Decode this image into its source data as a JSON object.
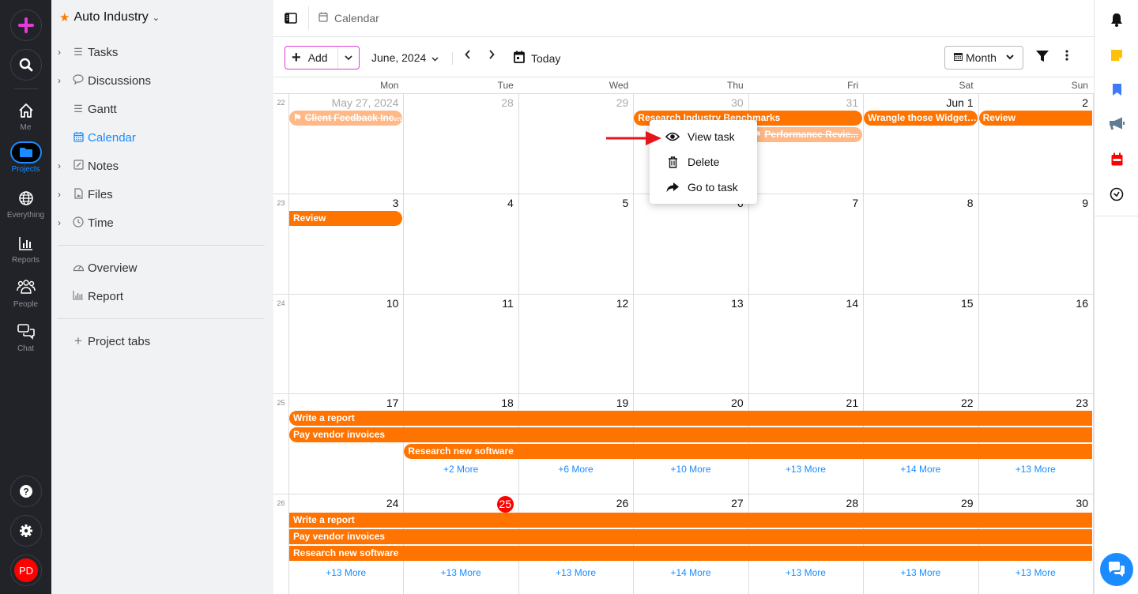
{
  "rail": {
    "items": [
      {
        "label": "Me",
        "icon": "home-icon"
      },
      {
        "label": "Projects",
        "icon": "folder-icon",
        "active": true
      },
      {
        "label": "Everything",
        "icon": "globe-icon"
      },
      {
        "label": "Reports",
        "icon": "bar-chart-icon"
      },
      {
        "label": "People",
        "icon": "people-icon"
      },
      {
        "label": "Chat",
        "icon": "chat-icon"
      }
    ],
    "avatar_initials": "PD"
  },
  "sidebar": {
    "project_name": "Auto Industry",
    "items": [
      {
        "label": "Tasks",
        "expandable": true
      },
      {
        "label": "Discussions",
        "expandable": true
      },
      {
        "label": "Gantt",
        "expandable": false
      },
      {
        "label": "Calendar",
        "expandable": false,
        "active": true
      },
      {
        "label": "Notes",
        "expandable": true
      },
      {
        "label": "Files",
        "expandable": true
      },
      {
        "label": "Time",
        "expandable": true
      }
    ],
    "extra_items": [
      {
        "label": "Overview"
      },
      {
        "label": "Report"
      }
    ],
    "project_tabs_label": "Project tabs"
  },
  "topbar": {
    "breadcrumb": "Calendar"
  },
  "toolbar": {
    "add_label": "Add",
    "month_label": "June, 2024",
    "today_label": "Today",
    "view_label": "Month"
  },
  "calendar": {
    "weekdays": [
      "Mon",
      "Tue",
      "Wed",
      "Thu",
      "Fri",
      "Sat",
      "Sun"
    ],
    "weeks": [
      {
        "number": "22",
        "days": [
          "May 27, 2024",
          "28",
          "29",
          "30",
          "31",
          "Jun 1",
          "2"
        ],
        "dim": [
          true,
          true,
          true,
          true,
          true,
          false,
          false
        ]
      },
      {
        "number": "23",
        "days": [
          "3",
          "4",
          "5",
          "6",
          "7",
          "8",
          "9"
        ]
      },
      {
        "number": "24",
        "days": [
          "10",
          "11",
          "12",
          "13",
          "14",
          "15",
          "16"
        ]
      },
      {
        "number": "25",
        "days": [
          "17",
          "18",
          "19",
          "20",
          "21",
          "22",
          "23"
        ]
      },
      {
        "number": "26",
        "days": [
          "24",
          "25",
          "26",
          "27",
          "28",
          "29",
          "30"
        ],
        "today_index": 1
      }
    ],
    "events": {
      "client_feedback": "Client Feedback Inc...",
      "research_benchmarks": "Research Industry Benchmarks",
      "performance_review": "Performance Revie...",
      "wrangle_widgets": "Wrangle those Widgets...",
      "review": "Review",
      "write_report": "Write a report",
      "pay_vendor": "Pay vendor invoices",
      "research_software": "Research new software"
    },
    "more_week25": [
      "",
      "+2 More",
      "+6 More",
      "+10 More",
      "+13 More",
      "+14 More",
      "+13 More"
    ],
    "more_week26": [
      "+13 More",
      "+13 More",
      "+13 More",
      "+14 More",
      "+13 More",
      "+13 More",
      "+13 More"
    ]
  },
  "context_menu": {
    "items": [
      {
        "label": "View task",
        "icon": "eye-icon"
      },
      {
        "label": "Delete",
        "icon": "trash-icon"
      },
      {
        "label": "Go to task",
        "icon": "share-arrow-icon"
      }
    ]
  },
  "colors": {
    "accent": "#1a8cff",
    "event": "#ff7300",
    "event_done": "#ffb886",
    "today": "#ff0000",
    "add_border": "#e040d6"
  }
}
